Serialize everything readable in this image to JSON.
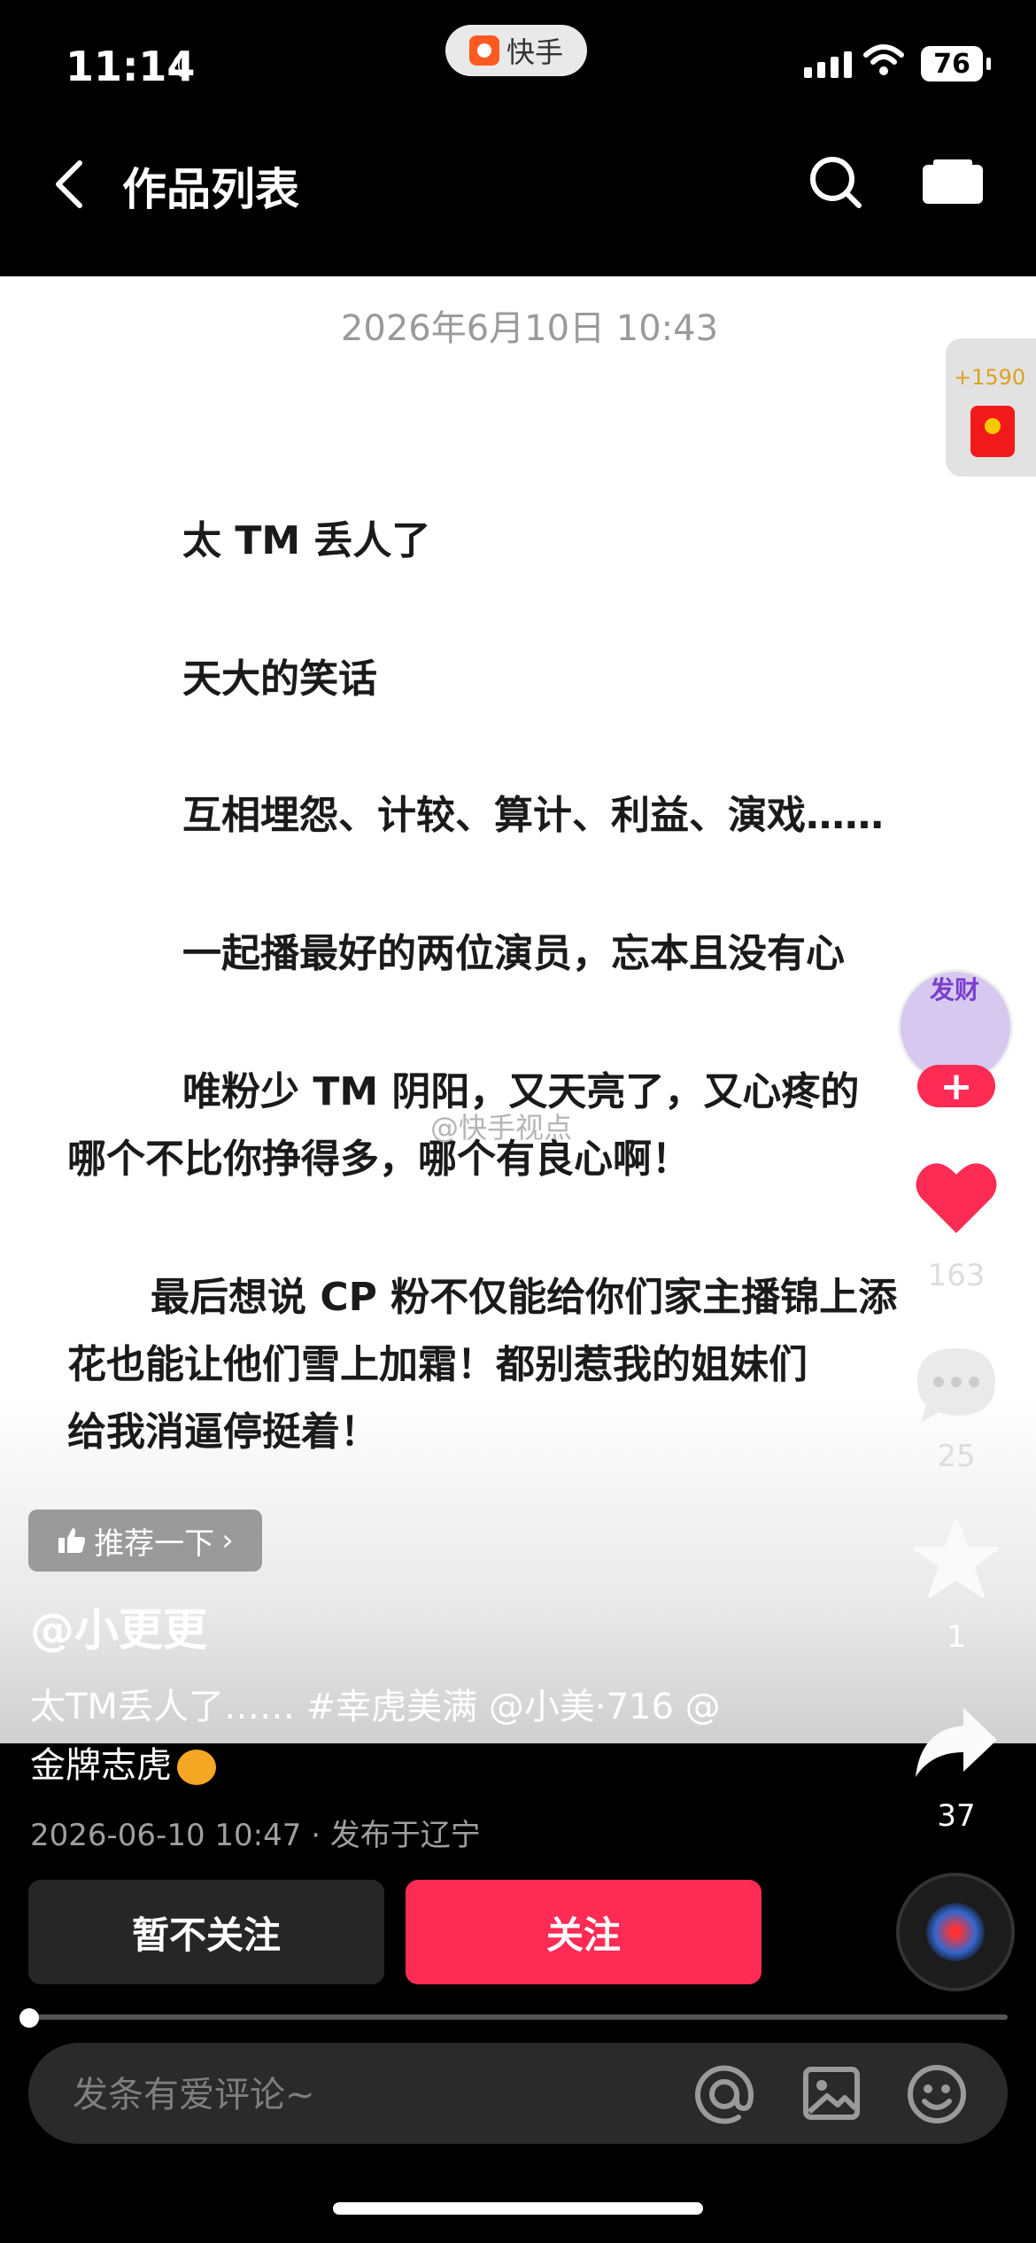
{
  "status_bar": {
    "time": "11:14",
    "app_name": "快手",
    "battery": "76"
  },
  "nav": {
    "title": "作品列表"
  },
  "post": {
    "date_top": "2026年6月10日 10:43",
    "paragraphs": [
      "太 TM 丢人了",
      "天大的笑话",
      "互相埋怨、计较、算计、利益、演戏……",
      "一起播最好的两位演员，忘本且没有心",
      "唯粉少 TM 阴阳，又天亮了，又心疼的",
      "哪个不比你挣得多，哪个有良心啊！",
      "最后想说 CP 粉不仅能给你们家主播锦上添",
      "花也能让他们雪上加霜！都别惹我的姐妹们",
      "给我消逼停挺着！"
    ],
    "watermark": "@快手视点"
  },
  "reward": {
    "label": "+1590"
  },
  "side": {
    "avatar_text": "发财",
    "like_count": "163",
    "comment_count": "25",
    "favorite_count": "1",
    "share_count": "37"
  },
  "meta": {
    "recommend": "推荐一下",
    "author": "@小更更",
    "desc_line1": "太TM丢人了…… #幸虎美满 @小美·716 @",
    "desc_line2": "金牌志虎",
    "published": "2026-06-10 10:47 · 发布于辽宁"
  },
  "actions": {
    "unfollow": "暂不关注",
    "follow": "关注"
  },
  "comment_box": {
    "placeholder": "发条有爱评论~"
  },
  "playback": {
    "progress": 0.0
  },
  "colors": {
    "accent": "#fe2c55",
    "background": "#000000"
  }
}
